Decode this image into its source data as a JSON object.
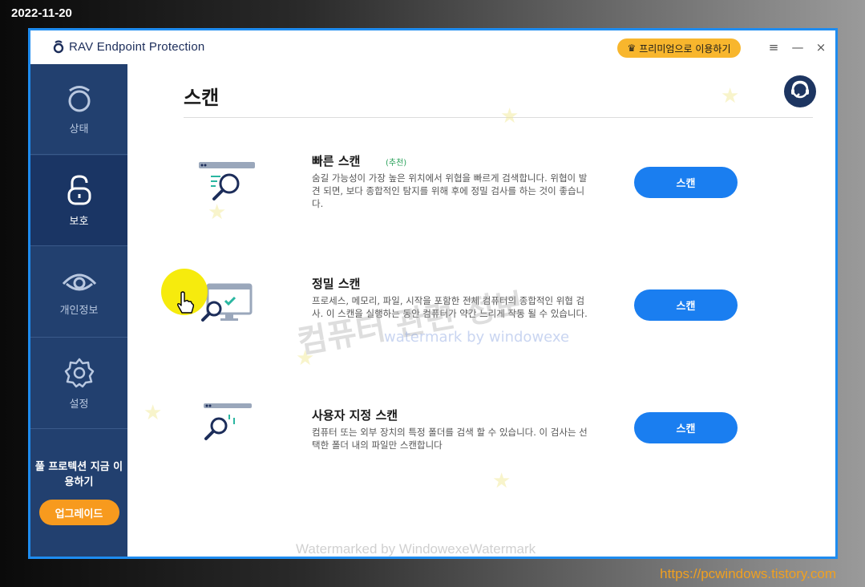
{
  "overlay": {
    "date": "2022-11-20",
    "url": "https://pcwindows.tistory.com"
  },
  "window": {
    "brand": "RAV Endpoint Protection",
    "premium_label": "프리미엄으로 이용하기",
    "controls": {
      "menu": "≡",
      "minimize": "—",
      "close": "×"
    }
  },
  "sidebar": {
    "items": [
      {
        "label": "상태",
        "icon": "status-icon",
        "active": false
      },
      {
        "label": "보호",
        "icon": "lock-icon",
        "active": true
      },
      {
        "label": "개인정보",
        "icon": "eye-icon",
        "active": false
      },
      {
        "label": "설정",
        "icon": "gear-icon",
        "active": false
      }
    ],
    "promo_text": "풀 프로텍션 지금 이용하기",
    "upgrade_label": "업그레이드"
  },
  "main": {
    "title": "스캔",
    "scans": [
      {
        "title": "빠른 스캔",
        "tag": "(추천)",
        "description": "숨길 가능성이 가장 높은 위치에서 위협을 빠르게 검색합니다. 위협이 발견 되면, 보다 종합적인 탐지를 위해 후에 정밀 검사를 하는 것이 좋습니다.",
        "button": "스캔"
      },
      {
        "title": "정밀 스캔",
        "tag": "",
        "description": "프로세스, 메모리, 파일, 시작을 포함한 전체 컴퓨터의 종합적인 위협 검사. 이 스캔을 실행하는 동안 컴퓨터가 약간 느리게 작동 될 수 있습니다.",
        "button": "스캔"
      },
      {
        "title": "사용자 지정 스캔",
        "tag": "",
        "description": "컴퓨터 또는 외부 장치의 특정 폴더를 검색 할 수 있습니다. 이 검사는 선택한 폴더 내의 파일만 스캔합니다",
        "button": "스캔"
      }
    ]
  },
  "watermarks": {
    "korean": "컴퓨터 관련 정보",
    "english": "watermark by windowexe",
    "bottom": "Watermarked by WindowexeWatermark"
  },
  "colors": {
    "sidebar": "#22406f",
    "accent": "#1a7ef0",
    "premium": "#f8b62d",
    "upgrade": "#f79a1e"
  }
}
